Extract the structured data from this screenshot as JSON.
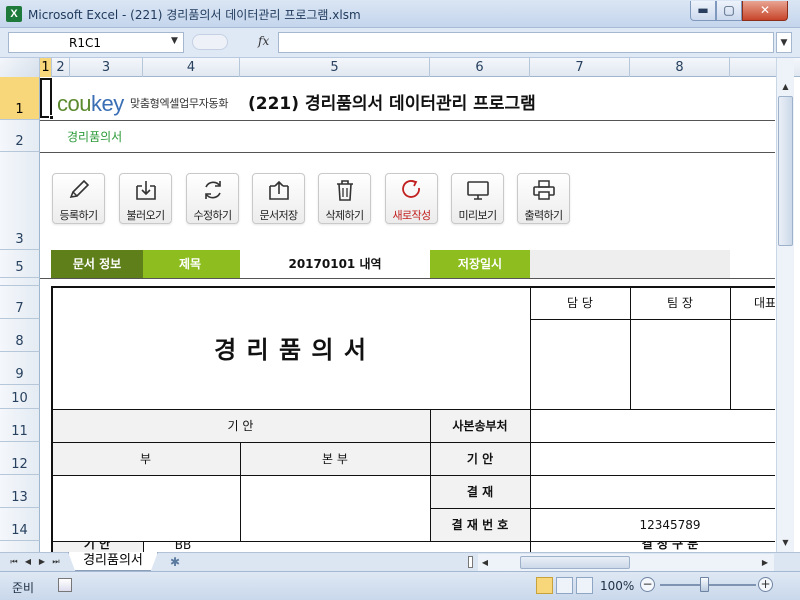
{
  "window": {
    "title": "Microsoft Excel - (221) 경리품의서 데이터관리 프로그램.xlsm",
    "app_icon": "X",
    "min_glyph": "▬",
    "max_glyph": "▢",
    "close_glyph": "✕"
  },
  "formula_bar": {
    "name_box": "R1C1",
    "fx_label": "fx",
    "formula": ""
  },
  "columns": [
    "1",
    "2",
    "3",
    "4",
    "5",
    "6",
    "7",
    "8"
  ],
  "rows": [
    "1",
    "2",
    "3",
    "5",
    "7",
    "8",
    "9",
    "10",
    "11",
    "12",
    "13",
    "14"
  ],
  "brand": {
    "logo_main": "cou",
    "logo_accent": "key",
    "tagline": "맞춤형엑셀업무자동화",
    "doc_title": "(221) 경리품의서 데이터관리 프로그램",
    "sheet_subtitle": "경리품의서"
  },
  "toolbar": [
    {
      "name": "register-button",
      "icon": "pencil-icon",
      "label": "등록하기"
    },
    {
      "name": "load-button",
      "icon": "download-icon",
      "label": "불러오기"
    },
    {
      "name": "modify-button",
      "icon": "refresh-icon",
      "label": "수정하기"
    },
    {
      "name": "save-doc-button",
      "icon": "upload-icon",
      "label": "문서저장"
    },
    {
      "name": "delete-button",
      "icon": "trash-icon",
      "label": "삭제하기"
    },
    {
      "name": "new-doc-button",
      "icon": "new-icon",
      "label": "새로작성"
    },
    {
      "name": "preview-button",
      "icon": "monitor-icon",
      "label": "미리보기"
    },
    {
      "name": "print-button",
      "icon": "printer-icon",
      "label": "출력하기"
    }
  ],
  "info": {
    "doc_info_label": "문서 정보",
    "title_label": "제목",
    "title_value": "20170101 내역",
    "save_date_label": "저장일시",
    "save_date_value": ""
  },
  "form": {
    "main_title": "경 리 품 의 서",
    "approval": [
      "담 당",
      "팀 장",
      "대표"
    ],
    "draft_header": "기           안",
    "copy_dept": "사본송부처",
    "dept": "부",
    "main_office": "본        부",
    "draft_label": "기        안",
    "approval_label": "결        재",
    "approval_no_label": "결 재 번 호",
    "approval_no_value": "12345789",
    "row15_label": "기 안",
    "row15_mid": "BB",
    "row15_right": "결 정 구 분"
  },
  "sheet_tabs": {
    "active": "경리품의서",
    "new_tab_glyph": "✱"
  },
  "status": {
    "ready": "준비",
    "zoom": "100%",
    "zoom_minus": "−",
    "zoom_plus": "+"
  }
}
